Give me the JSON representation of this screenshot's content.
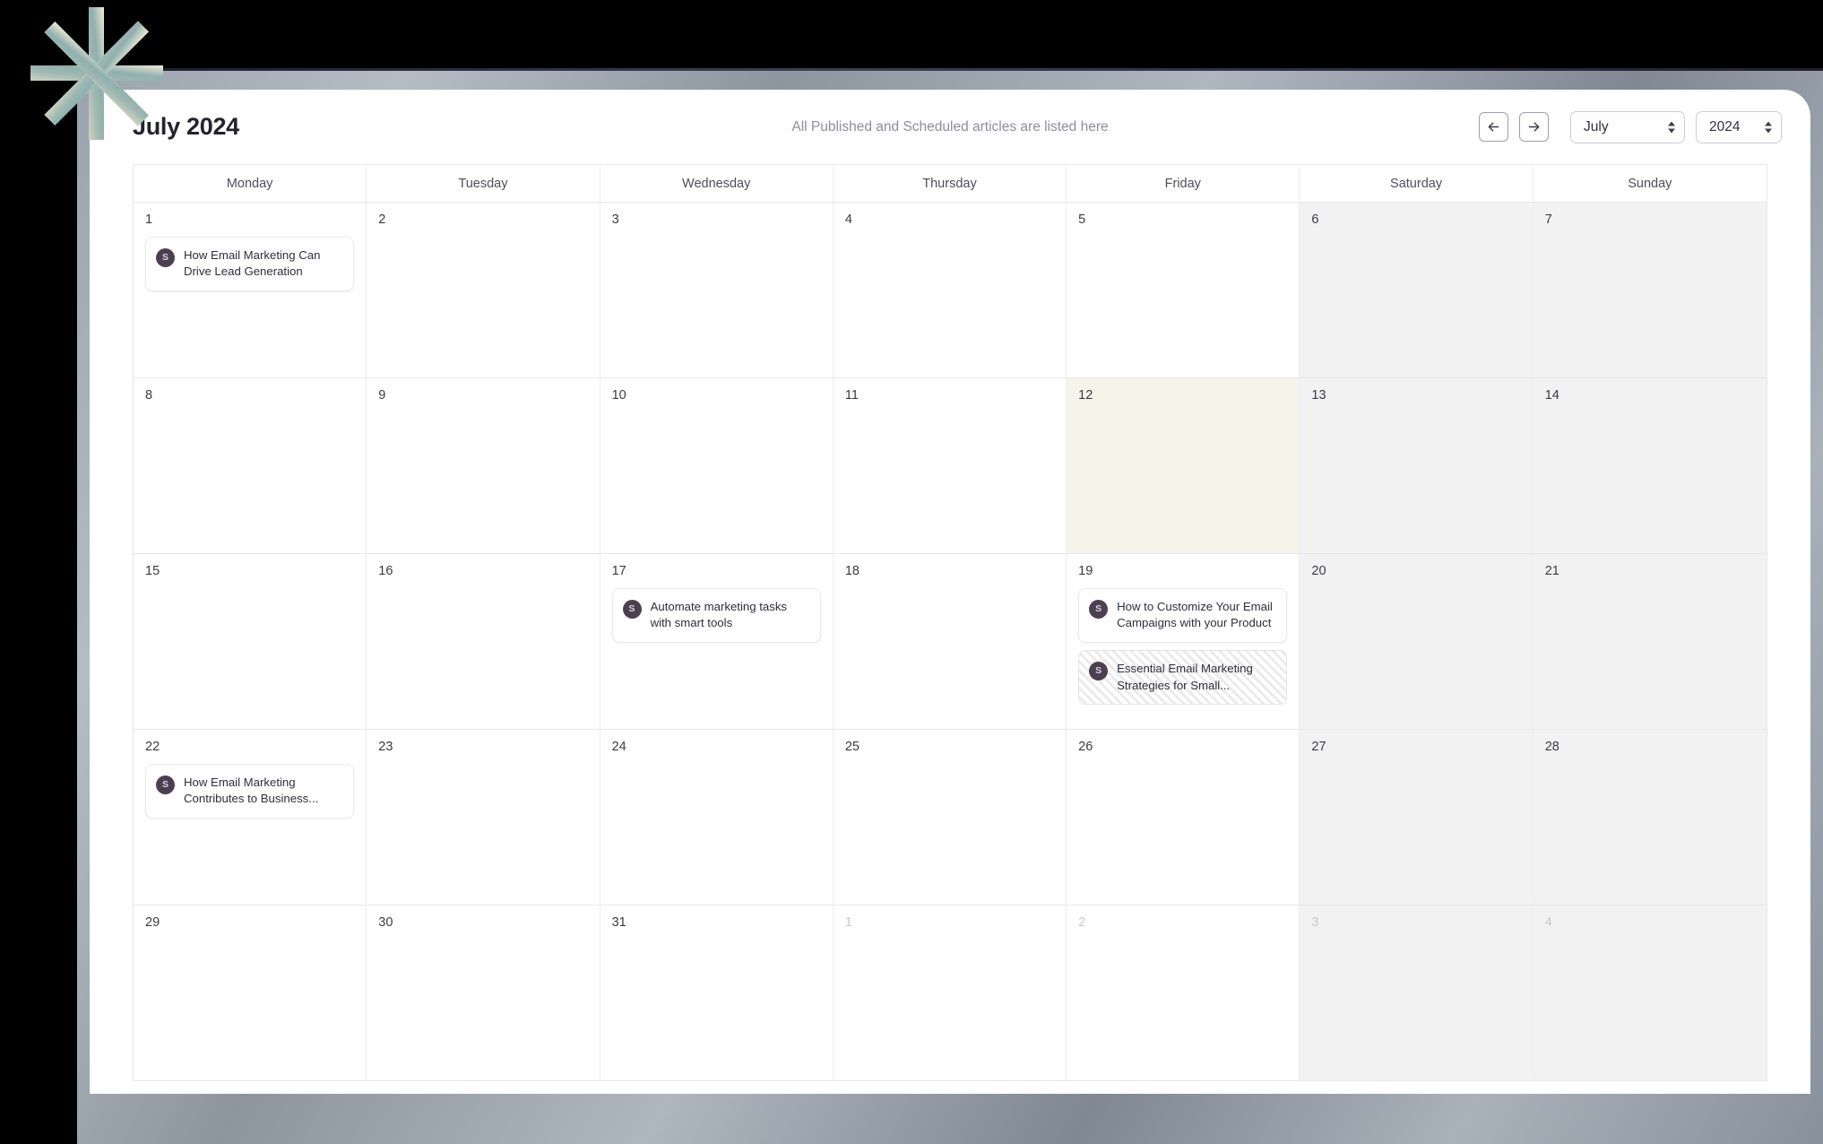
{
  "header": {
    "title": "July 2024",
    "subtitle": "All Published and Scheduled articles are listed here",
    "prev_icon": "arrow-left-icon",
    "next_icon": "arrow-right-icon",
    "month_select": {
      "value": "July"
    },
    "year_select": {
      "value": "2024"
    }
  },
  "weekdays": [
    "Monday",
    "Tuesday",
    "Wednesday",
    "Thursday",
    "Friday",
    "Saturday",
    "Sunday"
  ],
  "colors": {
    "avatar_bg": "#4c4050",
    "today_bg": "#f4f4ea",
    "weekend_bg": "#f2f2f2",
    "grid_line": "#e7e7e9"
  },
  "avatar_initial": "S",
  "weeks": [
    {
      "days": [
        {
          "num": "1",
          "outside": false,
          "weekend": false,
          "today": false,
          "events": [
            {
              "title": "How Email Marketing Can Drive Lead Generation",
              "avatar": "S",
              "state": "published"
            }
          ]
        },
        {
          "num": "2",
          "outside": false,
          "weekend": false,
          "today": false,
          "events": []
        },
        {
          "num": "3",
          "outside": false,
          "weekend": false,
          "today": false,
          "events": []
        },
        {
          "num": "4",
          "outside": false,
          "weekend": false,
          "today": false,
          "events": []
        },
        {
          "num": "5",
          "outside": false,
          "weekend": false,
          "today": false,
          "events": []
        },
        {
          "num": "6",
          "outside": false,
          "weekend": true,
          "today": false,
          "events": []
        },
        {
          "num": "7",
          "outside": false,
          "weekend": true,
          "today": false,
          "events": []
        }
      ]
    },
    {
      "days": [
        {
          "num": "8",
          "outside": false,
          "weekend": false,
          "today": false,
          "events": []
        },
        {
          "num": "9",
          "outside": false,
          "weekend": false,
          "today": false,
          "events": []
        },
        {
          "num": "10",
          "outside": false,
          "weekend": false,
          "today": false,
          "events": []
        },
        {
          "num": "11",
          "outside": false,
          "weekend": false,
          "today": false,
          "events": []
        },
        {
          "num": "12",
          "outside": false,
          "weekend": false,
          "today": true,
          "events": []
        },
        {
          "num": "13",
          "outside": false,
          "weekend": true,
          "today": false,
          "events": []
        },
        {
          "num": "14",
          "outside": false,
          "weekend": true,
          "today": false,
          "events": []
        }
      ]
    },
    {
      "days": [
        {
          "num": "15",
          "outside": false,
          "weekend": false,
          "today": false,
          "events": []
        },
        {
          "num": "16",
          "outside": false,
          "weekend": false,
          "today": false,
          "events": []
        },
        {
          "num": "17",
          "outside": false,
          "weekend": false,
          "today": false,
          "events": [
            {
              "title": "Automate marketing tasks with smart tools",
              "avatar": "S",
              "state": "published"
            }
          ]
        },
        {
          "num": "18",
          "outside": false,
          "weekend": false,
          "today": false,
          "events": []
        },
        {
          "num": "19",
          "outside": false,
          "weekend": false,
          "today": false,
          "events": [
            {
              "title": "How to Customize Your Email Campaigns with your Product",
              "avatar": "S",
              "state": "published"
            },
            {
              "title": "Essential Email Marketing Strategies for Small...",
              "avatar": "S",
              "state": "scheduled"
            }
          ]
        },
        {
          "num": "20",
          "outside": false,
          "weekend": true,
          "today": false,
          "events": []
        },
        {
          "num": "21",
          "outside": false,
          "weekend": true,
          "today": false,
          "events": []
        }
      ]
    },
    {
      "days": [
        {
          "num": "22",
          "outside": false,
          "weekend": false,
          "today": false,
          "events": [
            {
              "title": "How Email Marketing Contributes to Business...",
              "avatar": "S",
              "state": "published"
            }
          ]
        },
        {
          "num": "23",
          "outside": false,
          "weekend": false,
          "today": false,
          "events": []
        },
        {
          "num": "24",
          "outside": false,
          "weekend": false,
          "today": false,
          "events": []
        },
        {
          "num": "25",
          "outside": false,
          "weekend": false,
          "today": false,
          "events": []
        },
        {
          "num": "26",
          "outside": false,
          "weekend": false,
          "today": false,
          "events": []
        },
        {
          "num": "27",
          "outside": false,
          "weekend": true,
          "today": false,
          "events": []
        },
        {
          "num": "28",
          "outside": false,
          "weekend": true,
          "today": false,
          "events": []
        }
      ]
    },
    {
      "days": [
        {
          "num": "29",
          "outside": false,
          "weekend": false,
          "today": false,
          "events": []
        },
        {
          "num": "30",
          "outside": false,
          "weekend": false,
          "today": false,
          "events": []
        },
        {
          "num": "31",
          "outside": false,
          "weekend": false,
          "today": false,
          "events": []
        },
        {
          "num": "1",
          "outside": true,
          "weekend": false,
          "today": false,
          "events": []
        },
        {
          "num": "2",
          "outside": true,
          "weekend": false,
          "today": false,
          "events": []
        },
        {
          "num": "3",
          "outside": true,
          "weekend": true,
          "today": false,
          "events": []
        },
        {
          "num": "4",
          "outside": true,
          "weekend": true,
          "today": false,
          "events": []
        }
      ]
    }
  ]
}
